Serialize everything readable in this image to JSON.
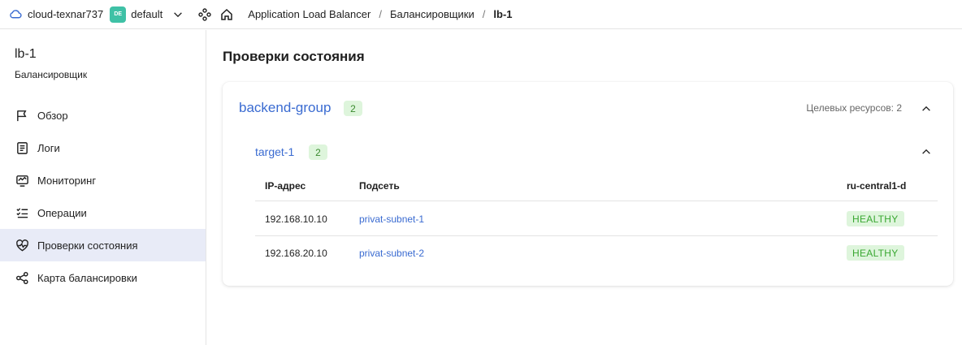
{
  "header": {
    "cloud_name": "cloud-texnar737",
    "folder_badge": "DE",
    "folder_name": "default",
    "breadcrumbs": [
      "Application Load Balancer",
      "Балансировщики",
      "lb-1"
    ],
    "separator": "/"
  },
  "sidebar": {
    "title": "lb-1",
    "subtitle": "Балансировщик",
    "items": [
      {
        "label": "Обзор",
        "icon": "flag-icon"
      },
      {
        "label": "Логи",
        "icon": "logs-icon"
      },
      {
        "label": "Мониторинг",
        "icon": "monitoring-icon"
      },
      {
        "label": "Операции",
        "icon": "operations-icon"
      },
      {
        "label": "Проверки состояния",
        "icon": "heartbeat-icon",
        "active": true
      },
      {
        "label": "Карта балансировки",
        "icon": "map-icon"
      }
    ]
  },
  "main": {
    "title": "Проверки состояния",
    "group": {
      "name": "backend-group",
      "count": "2",
      "targets_label": "Целевых ресурсов: 2",
      "target": {
        "name": "target-1",
        "count": "2",
        "columns": [
          "IP-адрес",
          "Подсеть",
          "ru-central1-d"
        ],
        "rows": [
          {
            "ip": "192.168.10.10",
            "subnet": "privat-subnet-1",
            "status": "HEALTHY"
          },
          {
            "ip": "192.168.20.10",
            "subnet": "privat-subnet-2",
            "status": "HEALTHY"
          }
        ]
      }
    }
  },
  "colors": {
    "accent": "#3a6bd1",
    "active_nav": "#e8ebf7",
    "healthy_bg": "#def5dc",
    "healthy_text": "#3aa832",
    "folder_badge": "#3fc1a6"
  }
}
